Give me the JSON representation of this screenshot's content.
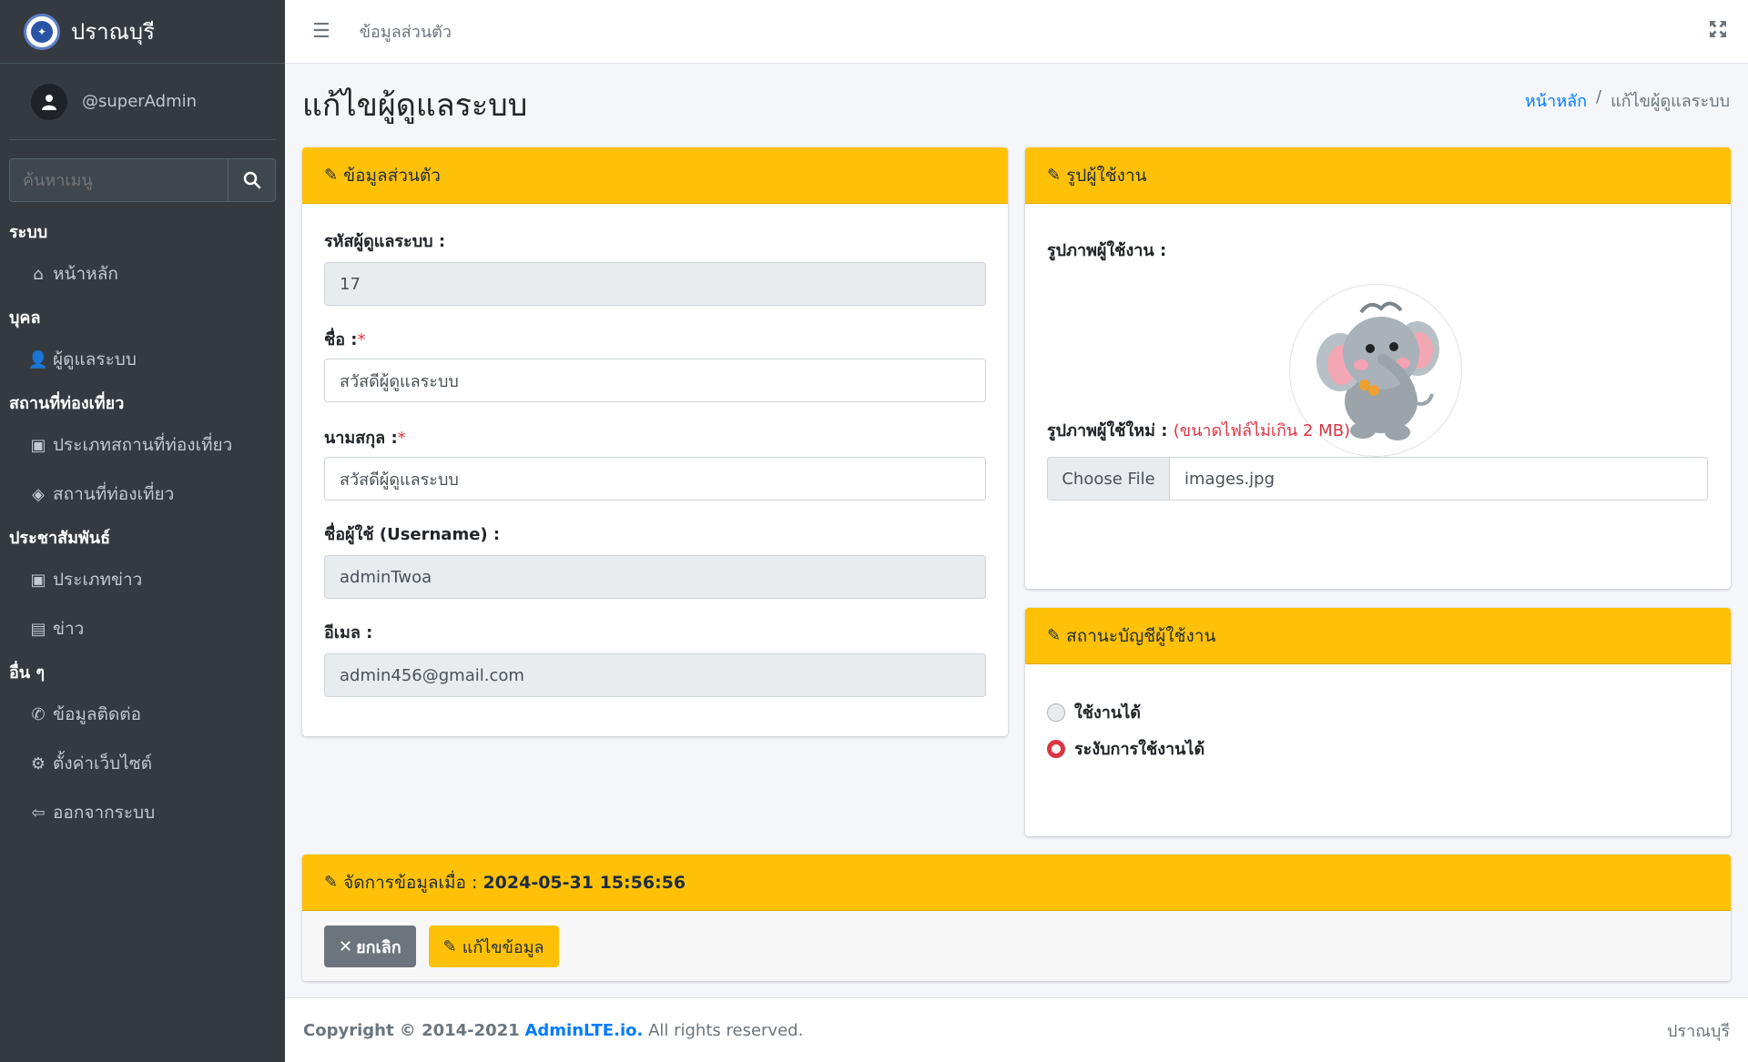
{
  "app": {
    "brand_name": "ปราณบุรี"
  },
  "user": {
    "name": "@superAdmin"
  },
  "sidebar": {
    "search_placeholder": "ค้นหาเมนู",
    "sections": [
      {
        "header": "ระบบ",
        "items": [
          {
            "label": "หน้าหลัก",
            "icon": "home-icon"
          }
        ]
      },
      {
        "header": "บุคล",
        "items": [
          {
            "label": "ผู้ดูแลระบบ",
            "icon": "user-cog-icon"
          }
        ]
      },
      {
        "header": "สถานที่ท่องเที่ยว",
        "items": [
          {
            "label": "ประเภทสถานที่ท่องเที่ยว",
            "icon": "book-icon"
          },
          {
            "label": "สถานที่ท่องเที่ยว",
            "icon": "map-icon"
          }
        ]
      },
      {
        "header": "ประชาสัมพันธ์",
        "items": [
          {
            "label": "ประเภทข่าว",
            "icon": "book-icon"
          },
          {
            "label": "ข่าว",
            "icon": "newspaper-icon"
          }
        ]
      },
      {
        "header": "อื่น ๆ",
        "items": [
          {
            "label": "ข้อมูลติดต่อ",
            "icon": "phone-icon"
          },
          {
            "label": "ตั้งค่าเว็บไซต์",
            "icon": "gears-icon"
          },
          {
            "label": "ออกจากระบบ",
            "icon": "sign-out-icon"
          }
        ]
      }
    ]
  },
  "topbar": {
    "link": "ข้อมูลส่วนตัว"
  },
  "page": {
    "title": "แก้ไขผู้ดูแลระบบ",
    "breadcrumb": {
      "home": "หน้าหลัก",
      "separator": "/",
      "current": "แก้ไขผู้ดูแลระบบ"
    }
  },
  "personal_card": {
    "title": "ข้อมูลส่วนตัว",
    "id_label": "รหัสผู้ดูแลระบบ :",
    "id_value": "17",
    "firstname_label": "ชื่อ :",
    "firstname_value": "สวัสดีผู้ดูแลระบบ",
    "lastname_label": "นามสกุล :",
    "lastname_value": "สวัสดีผู้ดูแลระบบ",
    "username_label": "ชื่อผู้ใช้ (Username) :",
    "username_value": "adminTwoa",
    "email_label": "อีเมล :",
    "email_value": "admin456@gmail.com",
    "required_mark": "*"
  },
  "photo_card": {
    "title": "รูปผู้ใช้งาน",
    "image_label": "รูปภาพผู้ใช้งาน :",
    "new_image_label": "รูปภาพผู้ใช้ใหม่ :",
    "size_hint": "(ขนาดไฟล์ไม่เกิน 2 MB)",
    "choose_file": "Choose File",
    "file_name": "images.jpg"
  },
  "status_card": {
    "title": "สถานะบัญชีผู้ใช้งาน",
    "options": [
      {
        "label": "ใช้งานได้",
        "checked": false
      },
      {
        "label": "ระงับการใช้งานได้",
        "checked": true
      }
    ]
  },
  "manage_card": {
    "title_prefix": "จัดการข้อมูลเมื่อ :",
    "timestamp": "2024-05-31 15:56:56",
    "cancel_label": "ยกเลิก",
    "edit_label": "แก้ไขข้อมูล"
  },
  "footer": {
    "copyright": "Copyright © 2014-2021",
    "brand": "AdminLTE.io.",
    "rights": "All rights reserved.",
    "right_text": "ปราณบุรี"
  },
  "colors": {
    "accent": "#ffc107",
    "link": "#007bff",
    "danger": "#dc3545",
    "sidebar": "#343a40"
  }
}
